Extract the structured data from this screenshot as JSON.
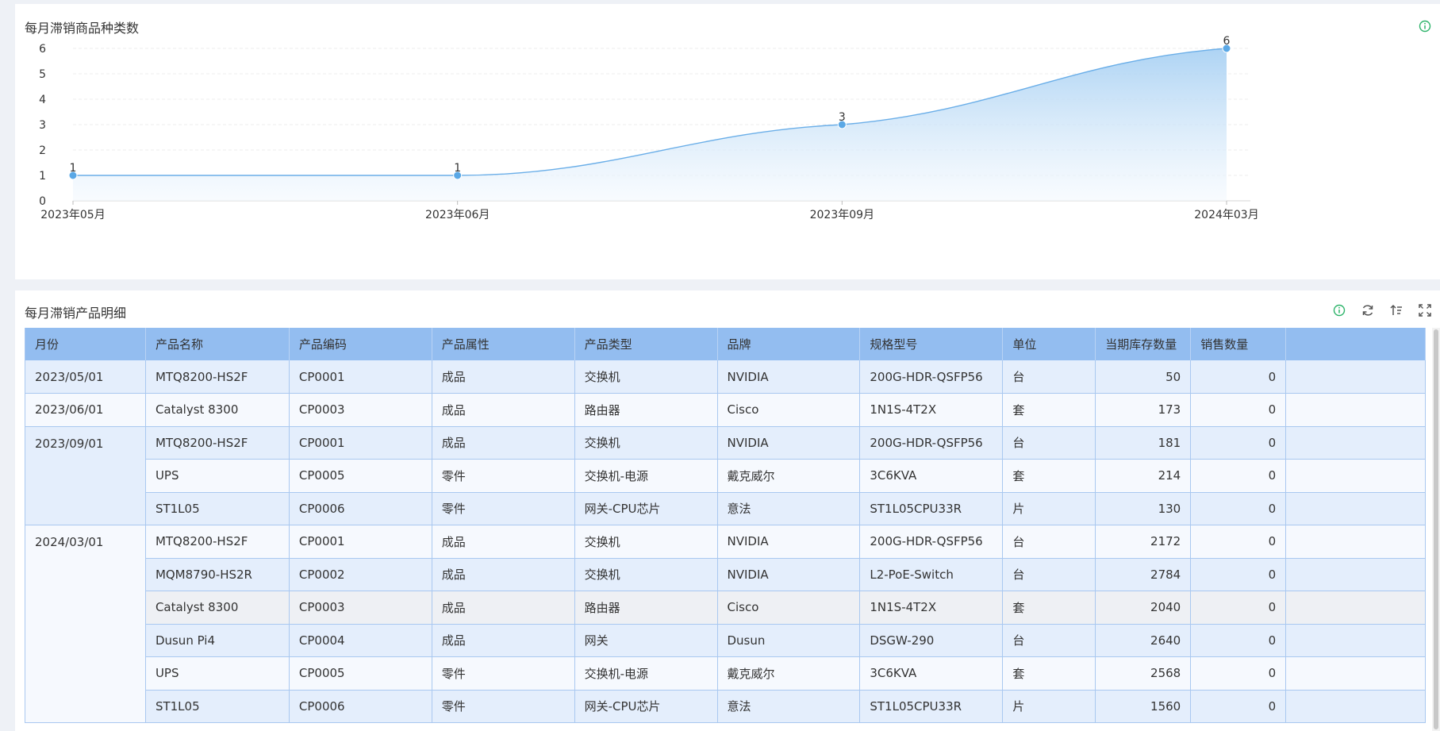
{
  "chart_panel": {
    "title": "每月滞销商品种类数"
  },
  "chart_data": {
    "type": "area",
    "title": "每月滞销商品种类数",
    "categories": [
      "2023年05月",
      "2023年06月",
      "2023年09月",
      "2024年03月"
    ],
    "values": [
      1,
      1,
      3,
      6
    ],
    "data_labels": [
      "1",
      "1",
      "3",
      "6"
    ],
    "ylim": [
      0,
      6
    ],
    "yticks": [
      "0",
      "1",
      "2",
      "3",
      "4",
      "5",
      "6"
    ],
    "grid": true,
    "smooth": true,
    "colors": {
      "line": "#6aaee8",
      "marker": "#5aa8e6",
      "fill_top": "#a9d1f3",
      "fill_bottom": "#f4f9fe"
    }
  },
  "table_panel": {
    "title": "每月滞销产品明细",
    "columns": [
      "月份",
      "产品名称",
      "产品编码",
      "产品属性",
      "产品类型",
      "品牌",
      "规格型号",
      "单位",
      "当期库存数量",
      "销售数量"
    ],
    "groups": [
      {
        "month": "2023/05/01",
        "rows": [
          [
            "MTQ8200-HS2F",
            "CP0001",
            "成品",
            "交换机",
            "NVIDIA",
            "200G-HDR-QSFP56",
            "台",
            "50",
            "0"
          ]
        ]
      },
      {
        "month": "2023/06/01",
        "rows": [
          [
            "Catalyst 8300",
            "CP0003",
            "成品",
            "路由器",
            "Cisco",
            "1N1S-4T2X",
            "套",
            "173",
            "0"
          ]
        ]
      },
      {
        "month": "2023/09/01",
        "rows": [
          [
            "MTQ8200-HS2F",
            "CP0001",
            "成品",
            "交换机",
            "NVIDIA",
            "200G-HDR-QSFP56",
            "台",
            "181",
            "0"
          ],
          [
            "UPS",
            "CP0005",
            "零件",
            "交换机-电源",
            "戴克威尔",
            "3C6KVA",
            "套",
            "214",
            "0"
          ],
          [
            "ST1L05",
            "CP0006",
            "零件",
            "网关-CPU芯片",
            "意法",
            "ST1L05CPU33R",
            "片",
            "130",
            "0"
          ]
        ]
      },
      {
        "month": "2024/03/01",
        "rows": [
          [
            "MTQ8200-HS2F",
            "CP0001",
            "成品",
            "交换机",
            "NVIDIA",
            "200G-HDR-QSFP56",
            "台",
            "2172",
            "0"
          ],
          [
            "MQM8790-HS2R",
            "CP0002",
            "成品",
            "交换机",
            "NVIDIA",
            "L2-PoE-Switch",
            "台",
            "2784",
            "0"
          ],
          [
            "Catalyst 8300",
            "CP0003",
            "成品",
            "路由器",
            "Cisco",
            "1N1S-4T2X",
            "套",
            "2040",
            "0"
          ],
          [
            "Dusun Pi4",
            "CP0004",
            "成品",
            "网关",
            "Dusun",
            "DSGW-290",
            "台",
            "2640",
            "0"
          ],
          [
            "UPS",
            "CP0005",
            "零件",
            "交换机-电源",
            "戴克威尔",
            "3C6KVA",
            "套",
            "2568",
            "0"
          ],
          [
            "ST1L05",
            "CP0006",
            "零件",
            "网关-CPU芯片",
            "意法",
            "ST1L05CPU33R",
            "片",
            "1560",
            "0"
          ]
        ]
      }
    ]
  },
  "icons": {
    "info": "info-icon",
    "refresh": "refresh-icon",
    "sort": "sort-icon",
    "fullscreen": "fullscreen-icon"
  },
  "colors": {
    "header_bg": "#93bdf0",
    "row_a": "#e4eefc",
    "row_b": "#f6f9fe",
    "info_green": "#2fb46b"
  }
}
